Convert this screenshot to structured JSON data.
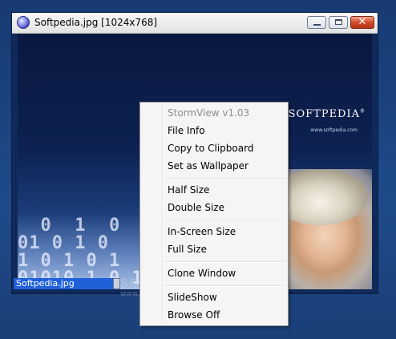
{
  "window": {
    "title": "Softpedia.jpg [1024x768]",
    "close_glyph": "✕"
  },
  "image": {
    "logo_text": "SOFTPEDIA",
    "logo_mark": "®",
    "logo_url": "www.softpedia.com",
    "binary_text": "  0  1  0\n01 0 1 0   1\n1 0 1 0 1  0 1\n01010 1 0 1 0 10",
    "filename": "Softpedia.jpg",
    "watermark": "SOFTPEDIA",
    "watermark_url": "www.softpedia.com"
  },
  "context_menu": {
    "header": "StormView v1.03",
    "items": [
      {
        "label": "File Info"
      },
      {
        "label": "Copy to Clipboard"
      },
      {
        "label": "Set as Wallpaper"
      },
      {
        "label": "Half Size"
      },
      {
        "label": "Double Size"
      },
      {
        "label": "In-Screen Size"
      },
      {
        "label": "Full Size"
      },
      {
        "label": "Clone Window"
      },
      {
        "label": "SlideShow"
      },
      {
        "label": "Browse Off"
      }
    ]
  },
  "colors": {
    "selection": "#2060d8",
    "close_button": "#d14a2a",
    "menu_bg": "#f5f5f5",
    "disabled_text": "#8d8d8d"
  },
  "icons": {
    "app_icon": "stormview-globe-icon",
    "minimize": "minimize-icon",
    "maximize": "maximize-icon",
    "close": "close-icon"
  }
}
